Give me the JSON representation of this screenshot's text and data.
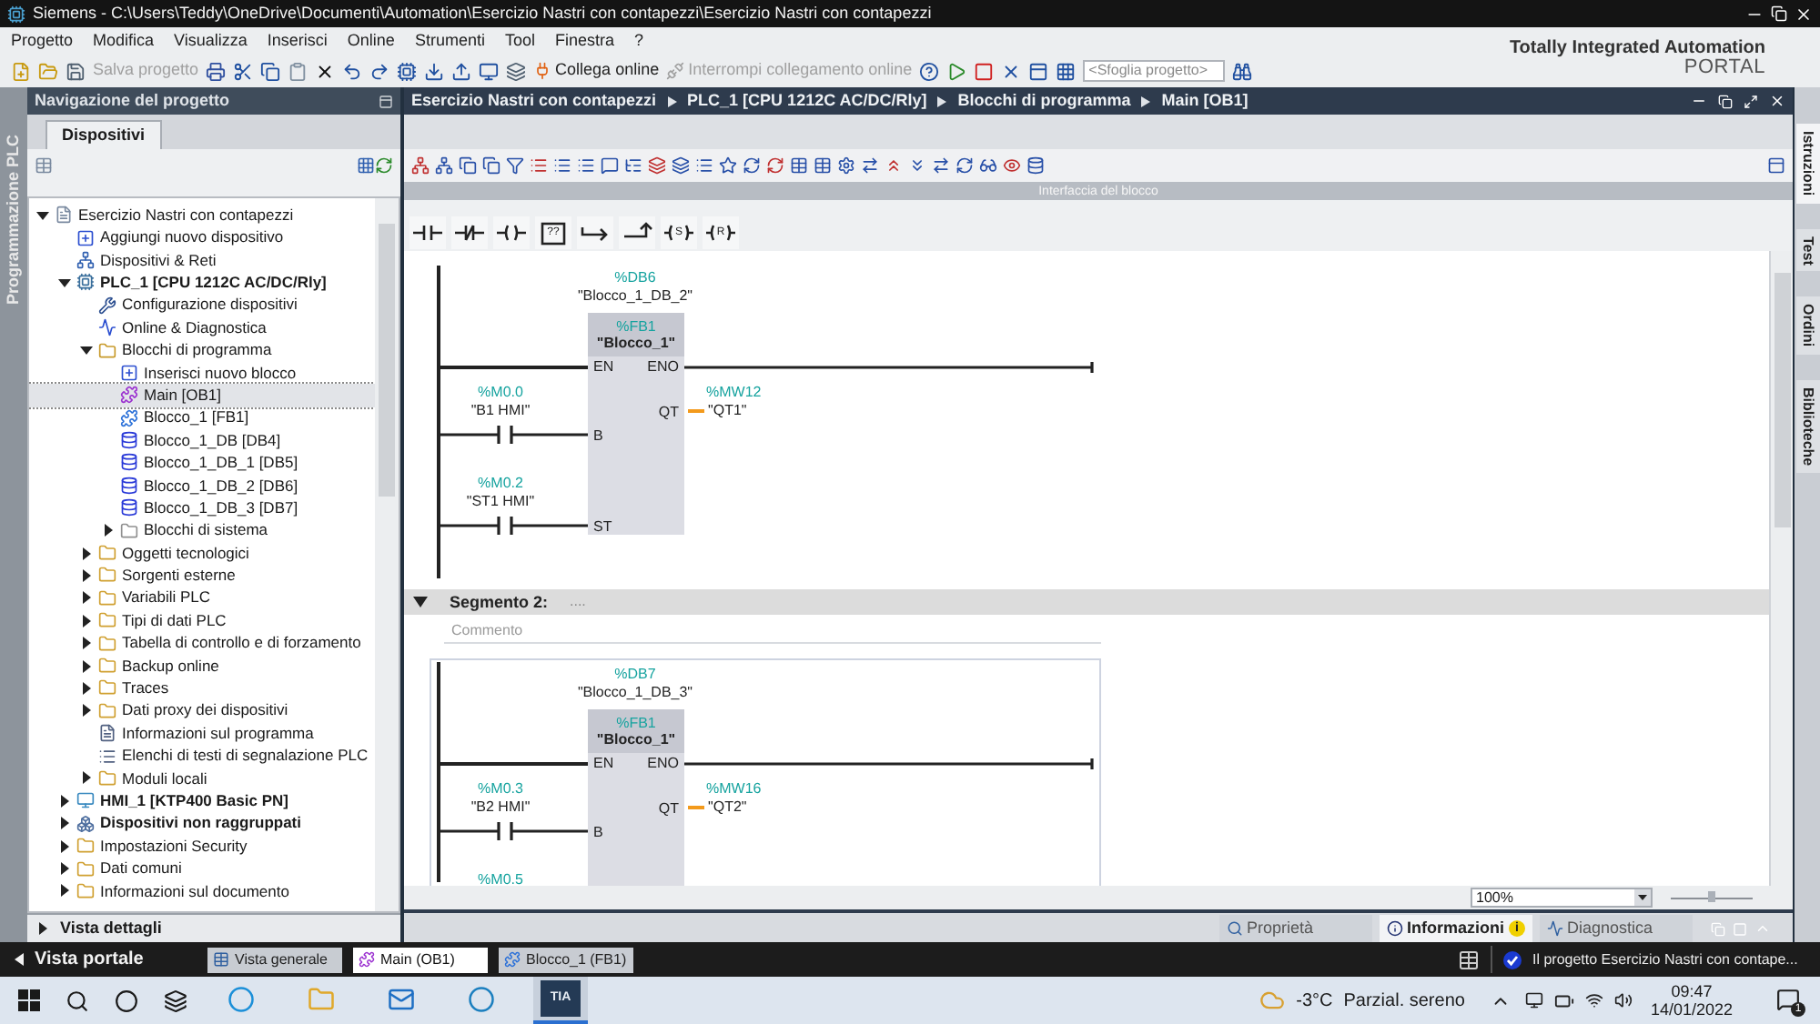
{
  "title_bar": {
    "title": "Siemens  -  C:\\Users\\Teddy\\OneDrive\\Documenti\\Automation\\Esercizio Nastri con contapezzi\\Esercizio Nastri con contapezzi"
  },
  "menu": [
    "Progetto",
    "Modifica",
    "Visualizza",
    "Inserisci",
    "Online",
    "Strumenti",
    "Tool",
    "Finestra",
    "?"
  ],
  "toolbar": {
    "save": {
      "label": "Salva progetto",
      "disabled": true
    },
    "go_online": {
      "label": "Collega online",
      "disabled": false
    },
    "go_offline": {
      "label": "Interrompi collegamento online",
      "disabled": true
    },
    "search": {
      "placeholder": "<Sfoglia progetto>"
    }
  },
  "brand": {
    "line1": "Totally Integrated Automation",
    "line2": "PORTAL"
  },
  "side_strip": {
    "label": "Programmazione PLC"
  },
  "project_nav": {
    "title": "Navigazione del progetto",
    "tabs": [
      {
        "label": "Dispositivi",
        "selected": true
      }
    ],
    "tree": [
      {
        "label": "Esercizio Nastri con contapezzi",
        "kind": "project",
        "expanded": true,
        "selected": false,
        "children": [
          {
            "label": "Aggiungi nuovo dispositivo",
            "kind": "add",
            "selected": false
          },
          {
            "label": "Dispositivi & Reti",
            "kind": "network",
            "selected": false
          },
          {
            "label": "PLC_1 [CPU 1212C AC/DC/Rly]",
            "kind": "plc",
            "expanded": true,
            "selected": false,
            "children": [
              {
                "label": "Configurazione dispositivi",
                "kind": "config",
                "selected": false
              },
              {
                "label": "Online & Diagnostica",
                "kind": "online",
                "selected": false
              },
              {
                "label": "Blocchi di programma",
                "kind": "blocks",
                "expanded": true,
                "selected": false,
                "children": [
                  {
                    "label": "Inserisci nuovo blocco",
                    "kind": "add",
                    "selected": false
                  },
                  {
                    "label": "Main [OB1]",
                    "kind": "ob",
                    "selected": true
                  },
                  {
                    "label": "Blocco_1 [FB1]",
                    "kind": "fb",
                    "selected": false
                  },
                  {
                    "label": "Blocco_1_DB [DB4]",
                    "kind": "db",
                    "selected": false
                  },
                  {
                    "label": "Blocco_1_DB_1 [DB5]",
                    "kind": "db",
                    "selected": false
                  },
                  {
                    "label": "Blocco_1_DB_2 [DB6]",
                    "kind": "db",
                    "selected": false
                  },
                  {
                    "label": "Blocco_1_DB_3 [DB7]",
                    "kind": "db",
                    "selected": false
                  },
                  {
                    "label": "Blocchi di sistema",
                    "kind": "sysfolder",
                    "expanded": false,
                    "selected": false
                  }
                ]
              },
              {
                "label": "Oggetti tecnologici",
                "kind": "folder",
                "expanded": false,
                "selected": false
              },
              {
                "label": "Sorgenti esterne",
                "kind": "folder",
                "expanded": false,
                "selected": false
              },
              {
                "label": "Variabili PLC",
                "kind": "folder",
                "expanded": false,
                "selected": false
              },
              {
                "label": "Tipi di dati PLC",
                "kind": "folder",
                "expanded": false,
                "selected": false
              },
              {
                "label": "Tabella di controllo e di forzamento",
                "kind": "folder",
                "expanded": false,
                "selected": false
              },
              {
                "label": "Backup online",
                "kind": "folder",
                "expanded": false,
                "selected": false
              },
              {
                "label": "Traces",
                "kind": "folder",
                "expanded": false,
                "selected": false
              },
              {
                "label": "Dati proxy dei dispositivi",
                "kind": "folder",
                "expanded": false,
                "selected": false
              },
              {
                "label": "Informazioni sul programma",
                "kind": "info",
                "selected": false
              },
              {
                "label": "Elenchi di testi di segnalazione PLC",
                "kind": "list",
                "selected": false
              },
              {
                "label": "Moduli locali",
                "kind": "folder",
                "expanded": false,
                "selected": false
              }
            ]
          },
          {
            "label": "HMI_1 [KTP400 Basic PN]",
            "kind": "hmi",
            "expanded": false,
            "selected": false
          },
          {
            "label": "Dispositivi non raggruppati",
            "kind": "group",
            "expanded": false,
            "selected": false
          },
          {
            "label": "Impostazioni Security",
            "kind": "folder",
            "expanded": false,
            "selected": false
          },
          {
            "label": "Dati comuni",
            "kind": "folder",
            "expanded": false,
            "selected": false
          },
          {
            "label": "Informazioni sul documento",
            "kind": "folder",
            "expanded": false,
            "selected": false
          }
        ]
      }
    ],
    "details": {
      "label": "Vista dettagli"
    }
  },
  "editor": {
    "breadcrumb": [
      "Esercizio Nastri con contapezzi",
      "PLC_1 [CPU 1212C AC/DC/Rly]",
      "Blocchi di programma",
      "Main [OB1]"
    ],
    "interface_label": "Interfaccia del blocco",
    "lad_elements": [
      {
        "kind": "contact_no"
      },
      {
        "kind": "contact_nc"
      },
      {
        "kind": "coil"
      },
      {
        "kind": "box",
        "label": "??"
      },
      {
        "kind": "branch_open"
      },
      {
        "kind": "branch_close"
      },
      {
        "kind": "set",
        "label": "S"
      },
      {
        "kind": "reset",
        "label": "R"
      }
    ],
    "networks": [
      {
        "selected": false,
        "block": {
          "db": "%DB6",
          "db_name": "\"Blocco_1_DB_2\"",
          "fb": "%FB1",
          "fb_name": "\"Blocco_1\"",
          "en": "EN",
          "eno": "ENO",
          "inputs": [
            {
              "pin": "B",
              "address": "%M0.0",
              "name": "\"B1 HMI\""
            },
            {
              "pin": "ST",
              "address": "%M0.2",
              "name": "\"ST1 HMI\""
            }
          ],
          "outputs": [
            {
              "pin": "QT",
              "address": "%MW12",
              "name": "\"QT1\""
            }
          ]
        }
      },
      {
        "title": "Segmento 2:",
        "dots": "....",
        "comment_placeholder": "Commento",
        "expanded": true,
        "selected": true,
        "block": {
          "db": "%DB7",
          "db_name": "\"Blocco_1_DB_3\"",
          "fb": "%FB1",
          "fb_name": "\"Blocco_1\"",
          "en": "EN",
          "eno": "ENO",
          "inputs": [
            {
              "pin": "B",
              "address": "%M0.3",
              "name": "\"B2 HMI\""
            },
            {
              "address": "%M0.5"
            }
          ],
          "outputs": [
            {
              "pin": "QT",
              "address": "%MW16",
              "name": "\"QT2\""
            }
          ]
        }
      }
    ],
    "zoom": "100%",
    "zoom_slider": {
      "level": 0.5
    }
  },
  "inspector_tabs": [
    {
      "label": "Proprietà",
      "kind": "properties",
      "selected": false
    },
    {
      "label": "Informazioni",
      "kind": "info",
      "badge": "i",
      "selected": true
    },
    {
      "label": "Diagnostica",
      "kind": "diagnostics",
      "selected": false
    }
  ],
  "task_cards": [
    {
      "label": "Istruzioni",
      "selected": true
    },
    {
      "label": "Test",
      "selected": false
    },
    {
      "label": "Ordini",
      "selected": false
    },
    {
      "label": "Biblioteche",
      "selected": false
    }
  ],
  "portal_bar": {
    "portal_view": "Vista portale",
    "tabs": [
      {
        "label": "Vista generale",
        "kind": "overview",
        "selected": false
      },
      {
        "label": "Main (OB1)",
        "kind": "ob",
        "selected": true
      },
      {
        "label": "Blocco_1 (FB1)",
        "kind": "fb",
        "selected": false
      }
    ],
    "status": "Il progetto Esercizio Nastri con contape..."
  },
  "taskbar": {
    "apps": [
      {
        "kind": "edge",
        "selected": false
      },
      {
        "kind": "explorer",
        "selected": false
      },
      {
        "kind": "mail",
        "selected": false
      },
      {
        "kind": "dell",
        "selected": false
      },
      {
        "kind": "tia",
        "label": "TIA",
        "selected": true
      }
    ],
    "weather": {
      "temp": "-3°C",
      "text": "Parzial. sereno"
    },
    "time": "09:47",
    "date": "14/01/2022",
    "notifications": "1"
  }
}
